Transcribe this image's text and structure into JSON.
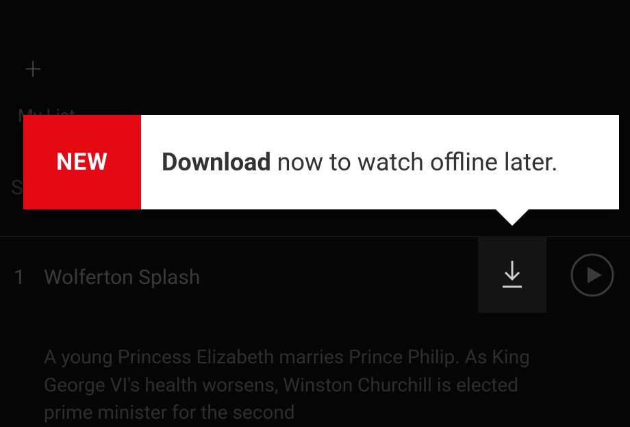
{
  "mylist": {
    "label": "My List"
  },
  "season": {
    "label": "S"
  },
  "episode": {
    "number": "1",
    "title": "Wolferton Splash",
    "description": "A young Princess Elizabeth marries Prince Philip. As King George VI's health worsens, Winston Churchill is elected prime minister for the second"
  },
  "tooltip": {
    "badge": "NEW",
    "bold": "Download",
    "rest": " now to watch offline later."
  }
}
